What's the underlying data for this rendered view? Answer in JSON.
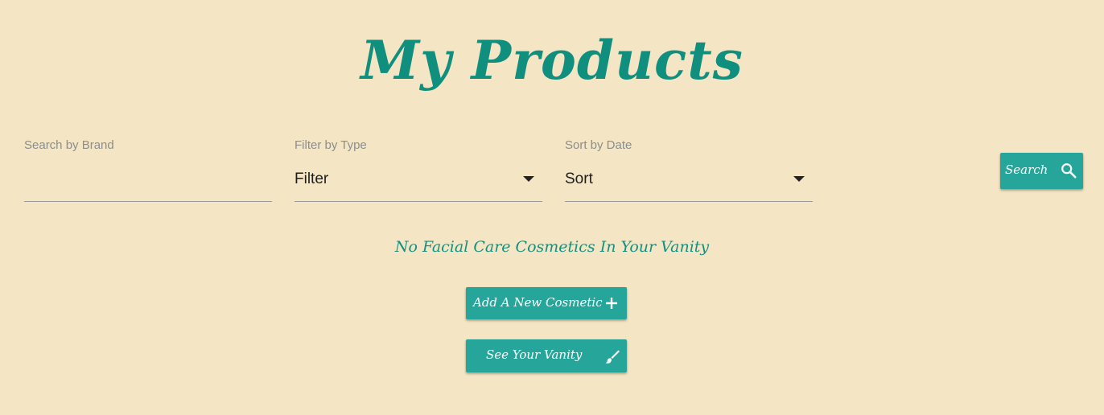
{
  "header": {
    "title": "My Products"
  },
  "filters": {
    "brand": {
      "label": "Search by Brand",
      "value": "",
      "placeholder": ""
    },
    "type": {
      "label": "Filter by Type",
      "value": "Filter"
    },
    "date": {
      "label": "Sort by Date",
      "value": "Sort"
    },
    "search_button": {
      "label": "Search",
      "icon": "search-icon"
    }
  },
  "content": {
    "empty_message": "No Facial Care Cosmetics In Your Vanity",
    "add_button": {
      "label": "Add A New Cosmetic",
      "icon": "plus-icon"
    },
    "vanity_button": {
      "label": "See Your Vanity",
      "icon": "brush-icon"
    }
  },
  "colors": {
    "background": "#f4e6c4",
    "accent": "#26a69a",
    "title": "#108f7f"
  }
}
